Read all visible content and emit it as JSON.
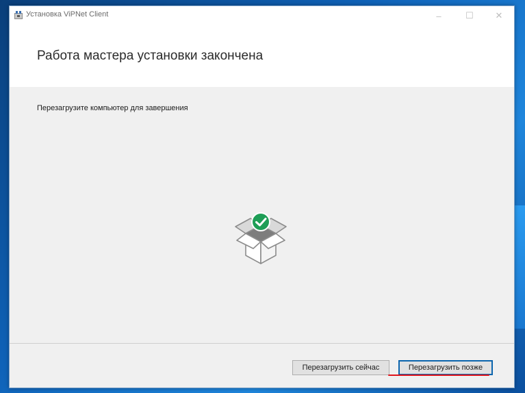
{
  "window": {
    "title": "Установка ViPNet Client",
    "controls": {
      "minimize": "–",
      "maximize": "☐",
      "close": "✕"
    }
  },
  "header": {
    "title": "Работа мастера установки закончена"
  },
  "main": {
    "message": "Перезагрузите компьютер для завершения"
  },
  "footer": {
    "restart_now_label": "Перезагрузить сейчас",
    "restart_later_label": "Перезагрузить позже"
  },
  "colors": {
    "success": "#1e9e56",
    "highlight": "#e0141c",
    "default_button_border": "#0a64ad"
  },
  "icons": {
    "app": "installer-icon",
    "illustration": "open-box-with-checkmark-icon"
  }
}
